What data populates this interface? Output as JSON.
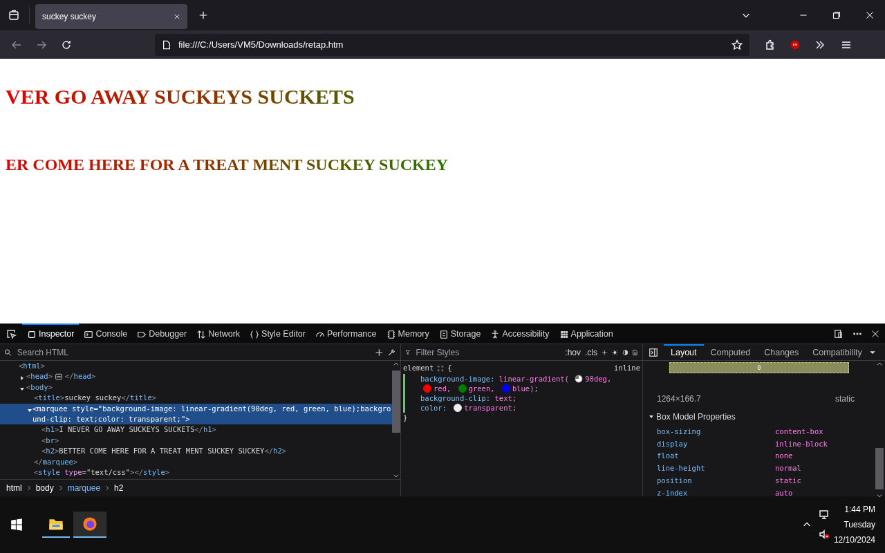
{
  "browser": {
    "tab_title": "suckey suckey",
    "url": "file:///C:/Users/VM5/Downloads/retap.htm"
  },
  "page": {
    "headings": [
      {
        "kind": "h1",
        "text": "VER GO AWAY SUCKEYS SUCKETS"
      },
      {
        "kind": "h2",
        "text": "ER COME HERE FOR A TREAT MENT SUCKEY SUCKEY"
      }
    ]
  },
  "devtools": {
    "tabs": [
      {
        "label": "Inspector",
        "selected": true
      },
      {
        "label": "Console",
        "selected": false
      },
      {
        "label": "Debugger",
        "selected": false
      },
      {
        "label": "Network",
        "selected": false
      },
      {
        "label": "Style Editor",
        "selected": false
      },
      {
        "label": "Performance",
        "selected": false
      },
      {
        "label": "Memory",
        "selected": false
      },
      {
        "label": "Storage",
        "selected": false
      },
      {
        "label": "Accessibility",
        "selected": false
      },
      {
        "label": "Application",
        "selected": false
      }
    ],
    "inspector": {
      "search": {
        "placeholder": "Search HTML"
      },
      "tree": [
        {
          "markup": "<html>",
          "selected": false,
          "children": [
            {
              "markup": "<head>",
              "close": "</head>",
              "expanded": false,
              "selected": false
            },
            {
              "markup": "<body>",
              "expanded": true,
              "selected": false,
              "children": [
                {
                  "markup": "<title>suckey suckey</title>",
                  "selected": false
                },
                {
                  "markup": "<marquee style=\"background-image: linear-gradient(90deg, red, green, blue);background-clip: text;color: transparent;\">",
                  "close": "</marquee>",
                  "expanded": true,
                  "selected": true,
                  "children": [
                    {
                      "markup": "<h1>I NEVER GO AWAY SUCKEYS SUCKETS</h1>",
                      "selected": false
                    },
                    {
                      "markup": "<br>",
                      "selected": false
                    },
                    {
                      "markup": "<h2>BETTER COME HERE FOR A TREAT MENT SUCKEY SUCKEY</h2>",
                      "selected": false
                    }
                  ]
                },
                {
                  "markup": "<style type=\"text/css\"></style>",
                  "selected": false
                }
              ]
            }
          ]
        }
      ],
      "breadcrumbs": [
        {
          "label": "html",
          "selected": false
        },
        {
          "label": "body",
          "selected": false
        },
        {
          "label": "marquee",
          "selected": true
        },
        {
          "label": "h2",
          "selected": false
        }
      ]
    },
    "rules": {
      "filter": {
        "placeholder": "Filter Styles"
      },
      "toggles": [
        ":hov",
        ".cls"
      ],
      "rule": {
        "selector": "element",
        "open": "{",
        "source": "inline",
        "close": "}",
        "declarations": [
          {
            "property": "background-image:",
            "parts": [
              {
                "kind": "text",
                "text": "linear-gradient("
              },
              {
                "kind": "angle",
                "text": "90deg,"
              },
              {
                "kind": "color",
                "color": "#ff0000",
                "text": "red,"
              },
              {
                "kind": "color",
                "color": "#008000",
                "text": "green,"
              },
              {
                "kind": "color",
                "color": "#0000ff",
                "text": "blue);"
              }
            ]
          },
          {
            "property": "background-clip:",
            "parts": [
              {
                "kind": "text",
                "text": "text;"
              }
            ]
          },
          {
            "property": "color:",
            "parts": [
              {
                "kind": "transparent",
                "text": "transparent;"
              }
            ]
          }
        ]
      }
    },
    "sidebar": {
      "tabs": [
        {
          "label": "Layout",
          "selected": true
        },
        {
          "label": "Computed",
          "selected": false
        },
        {
          "label": "Changes",
          "selected": false
        },
        {
          "label": "Compatibility",
          "selected": false
        }
      ],
      "box_value": "0",
      "dimensions": "1264×166.7",
      "position": "static",
      "section": {
        "title": "Box Model Properties",
        "expanded": true,
        "properties": [
          {
            "name": "box-sizing",
            "value": "content-box"
          },
          {
            "name": "display",
            "value": "inline-block"
          },
          {
            "name": "float",
            "value": "none"
          },
          {
            "name": "line-height",
            "value": "normal"
          },
          {
            "name": "position",
            "value": "static"
          },
          {
            "name": "z-index",
            "value": "auto"
          }
        ]
      }
    }
  },
  "taskbar": {
    "time": "1:44 PM",
    "day": "Tuesday",
    "date": "12/10/2024"
  }
}
